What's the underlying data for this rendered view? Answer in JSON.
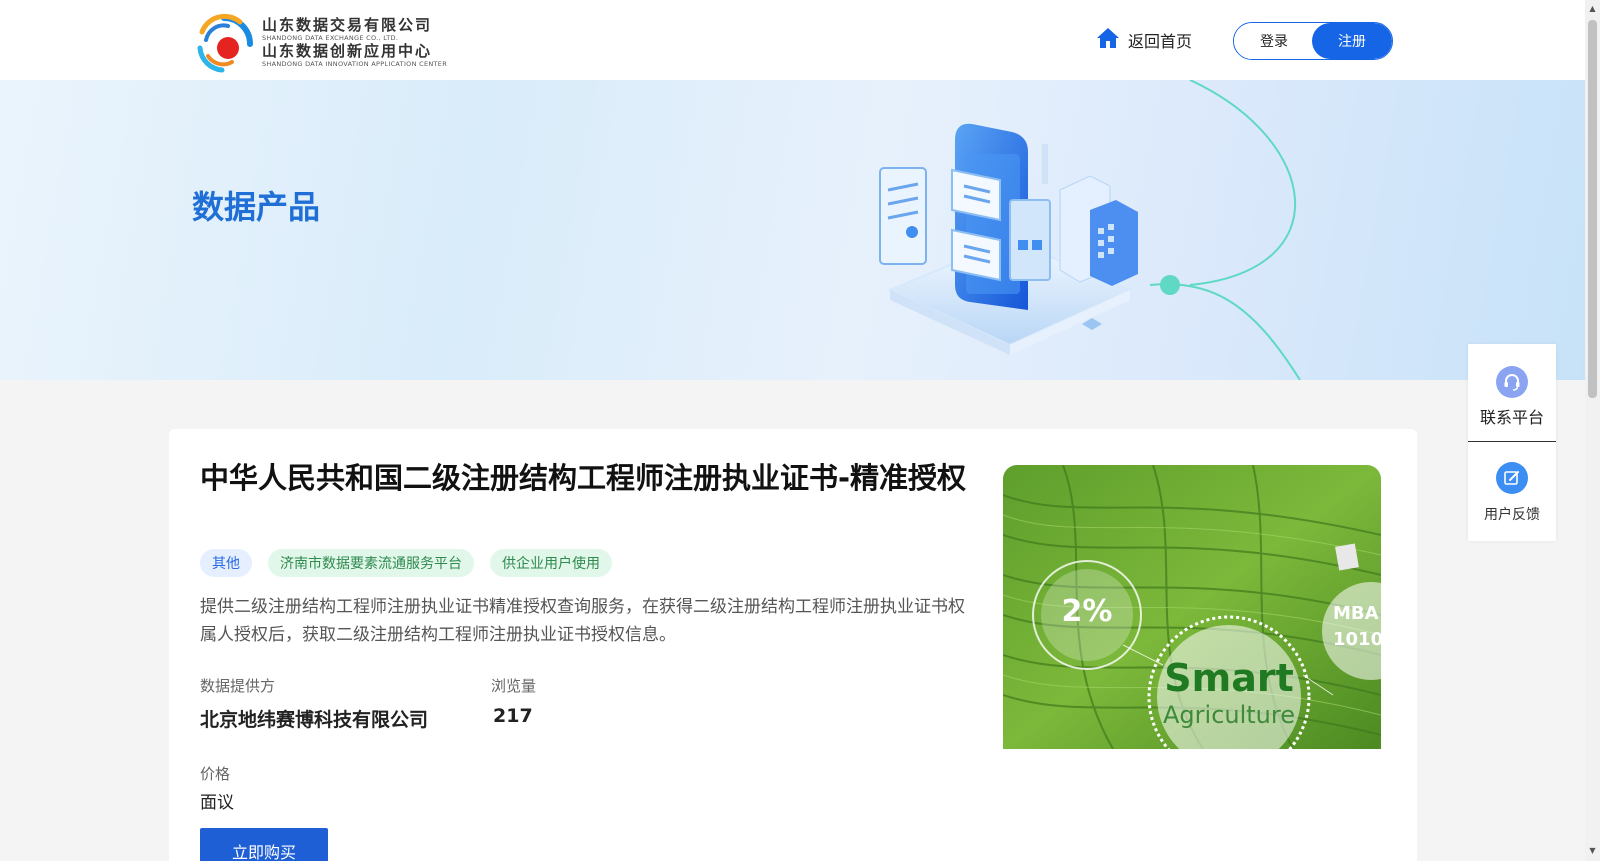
{
  "header": {
    "logo": {
      "name_cn_1": "山东数据交易有限公司",
      "name_en_1": "SHANDONG DATA EXCHANGE CO., LTD.",
      "name_cn_2": "山东数据创新应用中心",
      "name_en_2": "SHANDONG DATA INNOVATION APPLICATION CENTER"
    },
    "home_label": "返回首页",
    "login_label": "登录",
    "register_label": "注册"
  },
  "banner": {
    "title": "数据产品"
  },
  "product": {
    "title": "中华人民共和国二级注册结构工程师注册执业证书-精准授权",
    "tags": [
      {
        "label": "其他",
        "color": "blue"
      },
      {
        "label": "济南市数据要素流通服务平台",
        "color": "green"
      },
      {
        "label": "供企业用户使用",
        "color": "green"
      }
    ],
    "description": "提供二级注册结构工程师注册执业证书精准授权查询服务，在获得二级注册结构工程师注册执业证书权属人授权后，获取二级注册结构工程师注册执业证书授权信息。",
    "provider_label": "数据提供方",
    "provider_value": "北京地纬赛博科技有限公司",
    "views_label": "浏览量",
    "views_value": "217",
    "price_label": "价格",
    "price_value": "面议",
    "buy_label": "立即购买",
    "image": {
      "badge_percent": "2%",
      "headline": "Smart",
      "subline": "Agriculture",
      "side_text_1": "MBA",
      "side_text_2": "1010"
    }
  },
  "side_panel": {
    "contact_label": "联系平台",
    "feedback_label": "用户反馈"
  },
  "colors": {
    "primary": "#1565e6",
    "banner_title": "#1f6fd6",
    "tag_blue_bg": "#e5efff",
    "tag_green_bg": "#e1f7ea"
  },
  "icons": {
    "home": "home-icon",
    "contact": "headset-icon",
    "feedback": "edit-icon"
  }
}
